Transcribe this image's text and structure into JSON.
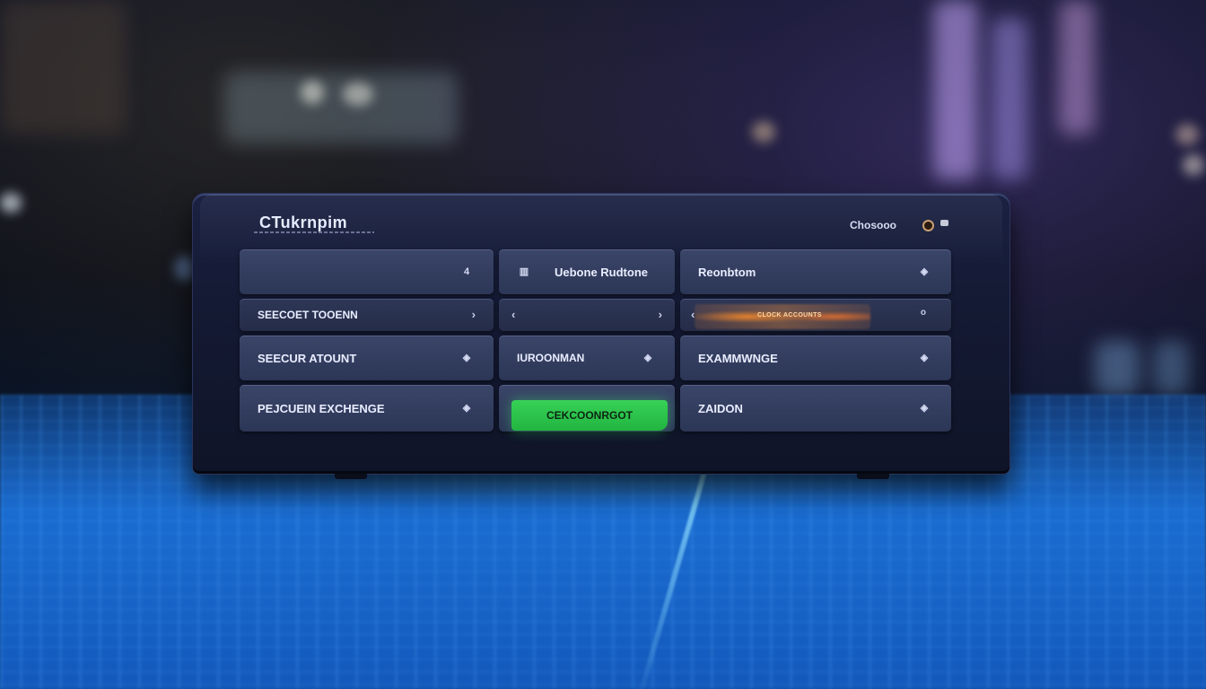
{
  "app": {
    "brand": "CTukrnpim",
    "top_right_label": "Chosooo"
  },
  "rows": [
    {
      "cells": [
        {
          "label": "",
          "icon": "4"
        },
        {
          "label": "Uebone Rudtone",
          "icon": ""
        },
        {
          "label": "Reonbtom",
          "icon": "◈"
        }
      ]
    },
    {
      "cells": [
        {
          "label": "SEECOET TOOENN",
          "icon": ""
        },
        {
          "label": "",
          "icon": ""
        },
        {
          "label": "CLOCK ACCOUNTS",
          "icon": ""
        }
      ]
    },
    {
      "cells": [
        {
          "label": "SEECUR ATOUNT",
          "icon": "◈"
        },
        {
          "label": "IUROONMAN",
          "icon": "◈"
        },
        {
          "label": "EXAMMWNGE",
          "icon": "◈"
        }
      ]
    },
    {
      "cells": [
        {
          "label": "PEJCUEIN EXCHENGE",
          "icon": "◈"
        },
        {
          "label": "CEKCOONRGOT",
          "icon": ""
        },
        {
          "label": "ZAIDON",
          "icon": "◈"
        }
      ]
    }
  ],
  "colors": {
    "accent_green": "#2ec44c",
    "accent_orange": "#ff8a30",
    "panel": "#2c3656"
  }
}
